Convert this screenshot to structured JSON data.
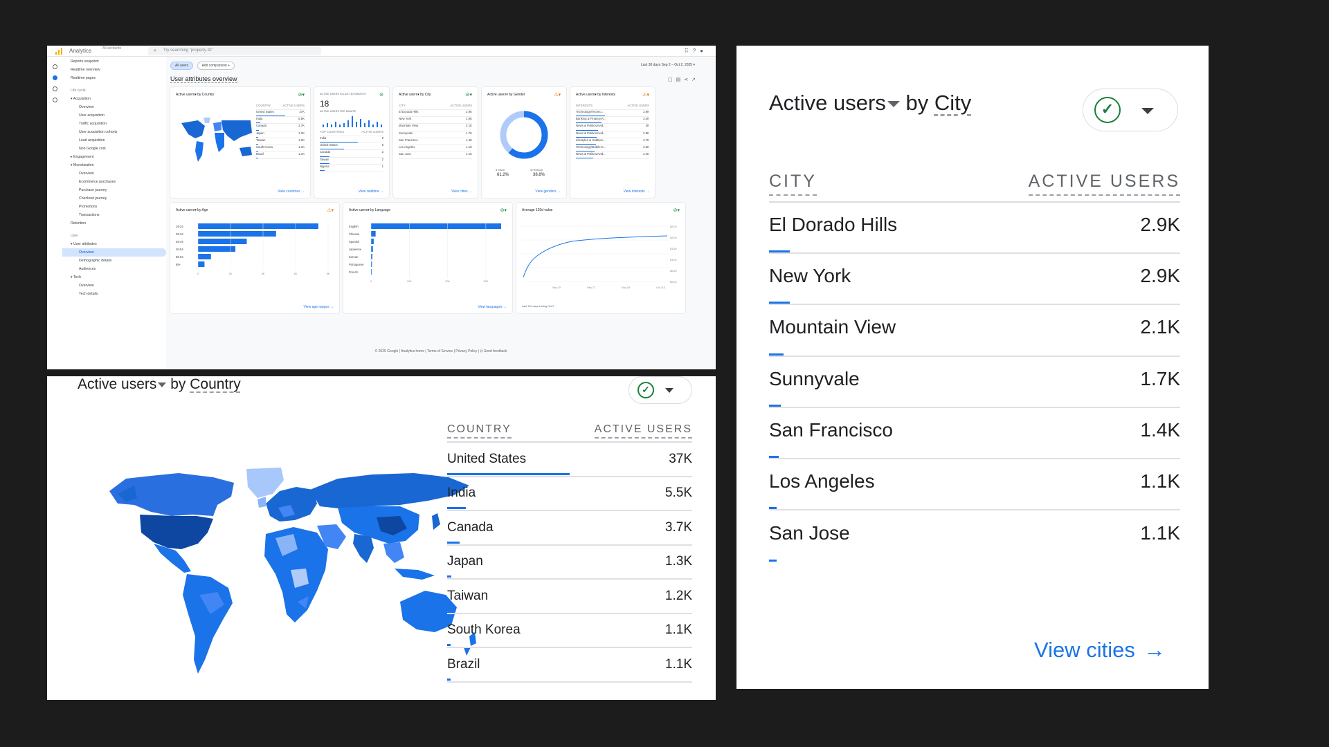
{
  "colors": {
    "accent": "#1a73e8",
    "ok": "#188038",
    "warn": "#e37400"
  },
  "dashboard": {
    "app_name": "Analytics",
    "account": "All accounts",
    "search_placeholder": "Try searching \"property ID\"",
    "nav": [
      {
        "label": "Reports snapshot",
        "type": "item"
      },
      {
        "label": "Realtime overview",
        "type": "item"
      },
      {
        "label": "Realtime pages",
        "type": "item"
      },
      {
        "label": "Life cycle",
        "type": "header"
      },
      {
        "label": "▾ Acquisition",
        "type": "item"
      },
      {
        "label": "Overview",
        "type": "sub"
      },
      {
        "label": "User acquisition",
        "type": "sub"
      },
      {
        "label": "Traffic acquisition",
        "type": "sub"
      },
      {
        "label": "User acquisition cohorts",
        "type": "sub"
      },
      {
        "label": "Lead acquisition",
        "type": "sub"
      },
      {
        "label": "Non Google cost",
        "type": "sub"
      },
      {
        "label": "▸ Engagement",
        "type": "item"
      },
      {
        "label": "▾ Monetization",
        "type": "item"
      },
      {
        "label": "Overview",
        "type": "sub"
      },
      {
        "label": "Ecommerce purchases",
        "type": "sub"
      },
      {
        "label": "Purchase journey",
        "type": "sub"
      },
      {
        "label": "Checkout journey",
        "type": "sub"
      },
      {
        "label": "Promotions",
        "type": "sub"
      },
      {
        "label": "Transactions",
        "type": "sub"
      },
      {
        "label": "Retention",
        "type": "item"
      },
      {
        "label": "User",
        "type": "header"
      },
      {
        "label": "▾ User attributes",
        "type": "item"
      },
      {
        "label": "Overview",
        "type": "selected"
      },
      {
        "label": "Demographic details",
        "type": "sub"
      },
      {
        "label": "Audiences",
        "type": "sub"
      },
      {
        "label": "▾ Tech",
        "type": "item"
      },
      {
        "label": "Overview",
        "type": "sub"
      },
      {
        "label": "Tech details",
        "type": "sub"
      }
    ],
    "chip_all_users": "All users",
    "chip_add_comparison": "Add comparison +",
    "date_range": "Last 30 days  Sep 2 – Oct 2, 2025 ▾",
    "page_title": "User attributes overview",
    "cards": {
      "country": {
        "title": "Active users▾ by Country",
        "link": "View countries →",
        "header": [
          "COUNTRY",
          "ACTIVE USERS"
        ],
        "rows": [
          [
            "United States",
            "37K"
          ],
          [
            "India",
            "5.5K"
          ],
          [
            "Canada",
            "3.7K"
          ],
          [
            "Japan",
            "1.3K"
          ],
          [
            "Taiwan",
            "1.2K"
          ],
          [
            "South Korea",
            "1.1K"
          ],
          [
            "Brazil",
            "1.1K"
          ]
        ]
      },
      "realtime": {
        "title": "ACTIVE USERS IN LAST 30 MINUTES",
        "value": "18",
        "sub": "ACTIVE USERS PER MINUTE",
        "link": "View realtime →",
        "header": [
          "TOP COUNTRIES",
          "ACTIVE USERS"
        ],
        "rows": [
          [
            "India",
            "8"
          ],
          [
            "United States",
            "5"
          ],
          [
            "Canada",
            "2"
          ],
          [
            "Taiwan",
            "2"
          ],
          [
            "Nigeria",
            "1"
          ]
        ]
      },
      "city_mini": {
        "title": "Active users▾ by City",
        "link": "View cities →"
      },
      "gender": {
        "title": "Active users▾ by Gender",
        "male_label": "● MALE",
        "male": "61.2%",
        "female_label": "● FEMALE",
        "female": "38.8%",
        "link": "View genders →"
      },
      "interests": {
        "title": "Active users▾ by Interests",
        "link": "View interests →",
        "header": [
          "INTERESTS",
          "ACTIVE USERS"
        ],
        "rows": [
          [
            "Technology/Techno...",
            "3.9K"
          ],
          [
            "Banking & Finance/A...",
            "3.4K"
          ],
          [
            "News & Politics/Avid...",
            "3K"
          ],
          [
            "News & Politics/Avid...",
            "2.8K"
          ],
          [
            "Lifestyles & Hobbies...",
            "2.7K"
          ],
          [
            "Technology/Mobile E...",
            "2.5K"
          ],
          [
            "News & Politics/Avid...",
            "2.4K"
          ]
        ]
      },
      "age": {
        "title": "Active users▾ by Age",
        "link": "View age ranges →",
        "categories": [
          "18-24",
          "25-34",
          "35-44",
          "45-54",
          "55-64",
          "65+"
        ],
        "values": [
          7400,
          4800,
          3000,
          2300,
          800,
          400
        ],
        "ticks": [
          "0",
          "2K",
          "4K",
          "6K",
          "8K"
        ]
      },
      "language": {
        "title": "Active users▾ by Language",
        "link": "View languages →",
        "categories": [
          "English",
          "Chinese",
          "Spanish",
          "Japanese",
          "Korean",
          "Portuguese",
          "French"
        ],
        "values": [
          34000,
          1200,
          700,
          500,
          350,
          250,
          200
        ],
        "ticks": [
          "0",
          "10K",
          "20K",
          "30K"
        ]
      },
      "ltv": {
        "title": "Average 120d value",
        "caption": "Last 120 days ending Oct 2",
        "yticks": [
          "$2.00",
          "$2.00",
          "$1.50",
          "$1.00",
          "$0.50",
          "$0.00"
        ],
        "xticks": [
          "Sep 20",
          "Sep 27",
          "Sep 28",
          "Oct 113"
        ]
      }
    },
    "footer": "© 2025 Google | Analytics home | Terms of Service | Privacy Policy | ⊡ Send feedback"
  },
  "country_zoom": {
    "title_metric": "Active users",
    "title_by": " by ",
    "title_dim": "Country",
    "col_dim": "COUNTRY",
    "col_metric": "ACTIVE USERS",
    "rows": [
      {
        "name": "United States",
        "value": "37K",
        "share": 1.0
      },
      {
        "name": "India",
        "value": "5.5K",
        "share": 0.15
      },
      {
        "name": "Canada",
        "value": "3.7K",
        "share": 0.1
      },
      {
        "name": "Japan",
        "value": "1.3K",
        "share": 0.035
      },
      {
        "name": "Taiwan",
        "value": "1.2K",
        "share": 0.032
      },
      {
        "name": "South Korea",
        "value": "1.1K",
        "share": 0.03
      },
      {
        "name": "Brazil",
        "value": "1.1K",
        "share": 0.03
      }
    ]
  },
  "city_zoom": {
    "title_metric": "Active users",
    "title_by": " by ",
    "title_dim": "City",
    "col_dim": "CITY",
    "col_metric": "ACTIVE USERS",
    "rows": [
      {
        "name": "El Dorado Hills",
        "value": "2.9K",
        "share": 0.05
      },
      {
        "name": "New York",
        "value": "2.9K",
        "share": 0.05
      },
      {
        "name": "Mountain View",
        "value": "2.1K",
        "share": 0.036
      },
      {
        "name": "Sunnyvale",
        "value": "1.7K",
        "share": 0.029
      },
      {
        "name": "San Francisco",
        "value": "1.4K",
        "share": 0.024
      },
      {
        "name": "Los Angeles",
        "value": "1.1K",
        "share": 0.019
      },
      {
        "name": "San Jose",
        "value": "1.1K",
        "share": 0.019
      }
    ],
    "view_link": "View cities"
  }
}
